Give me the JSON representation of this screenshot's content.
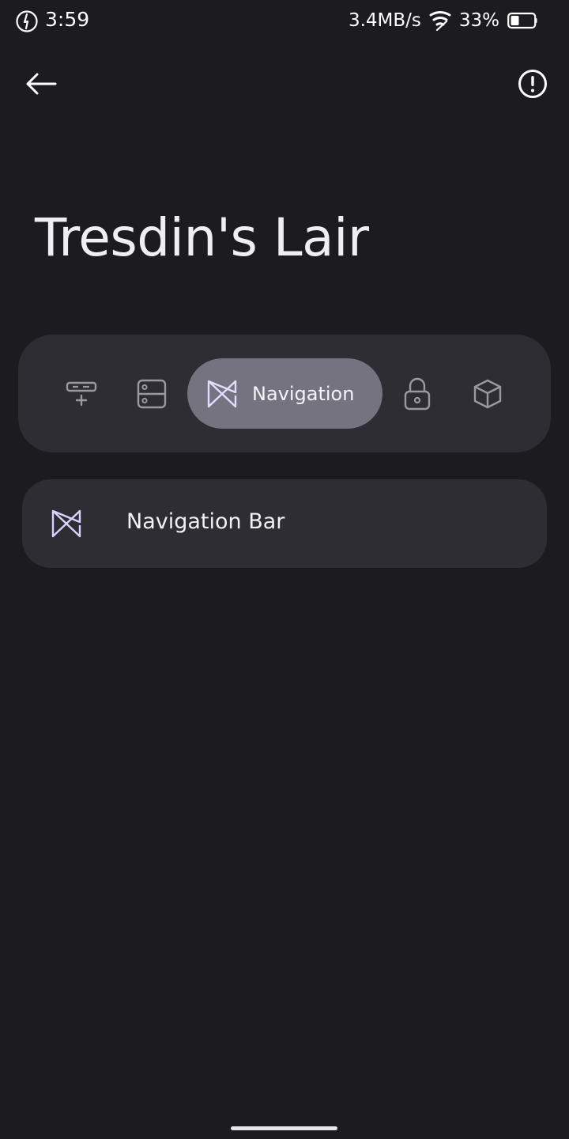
{
  "status_bar": {
    "time": "3:59",
    "network_speed": "3.4MB/s",
    "battery_percent": "33%",
    "icons": [
      "timer-icon",
      "wifi-icon",
      "battery-icon"
    ]
  },
  "app_bar": {
    "icons": [
      "back-arrow-icon",
      "info-icon"
    ]
  },
  "page": {
    "title": "Tresdin's Lair"
  },
  "categories": {
    "items": [
      {
        "icon": "keyboard-add-icon",
        "selected": false
      },
      {
        "icon": "server-icon",
        "selected": false
      },
      {
        "icon": "navigation-icon",
        "label": "Navigation",
        "selected": true
      },
      {
        "icon": "lock-icon",
        "selected": false
      },
      {
        "icon": "cube-icon",
        "selected": false
      }
    ]
  },
  "list": {
    "items": [
      {
        "icon": "navigation-icon",
        "label": "Navigation Bar"
      }
    ]
  },
  "colors": {
    "background": "#1c1b20",
    "surface": "#2e2d33",
    "selected_chip": "#75737f",
    "accent_icon": "#d9d2ff",
    "muted_icon": "#9a99a3"
  }
}
